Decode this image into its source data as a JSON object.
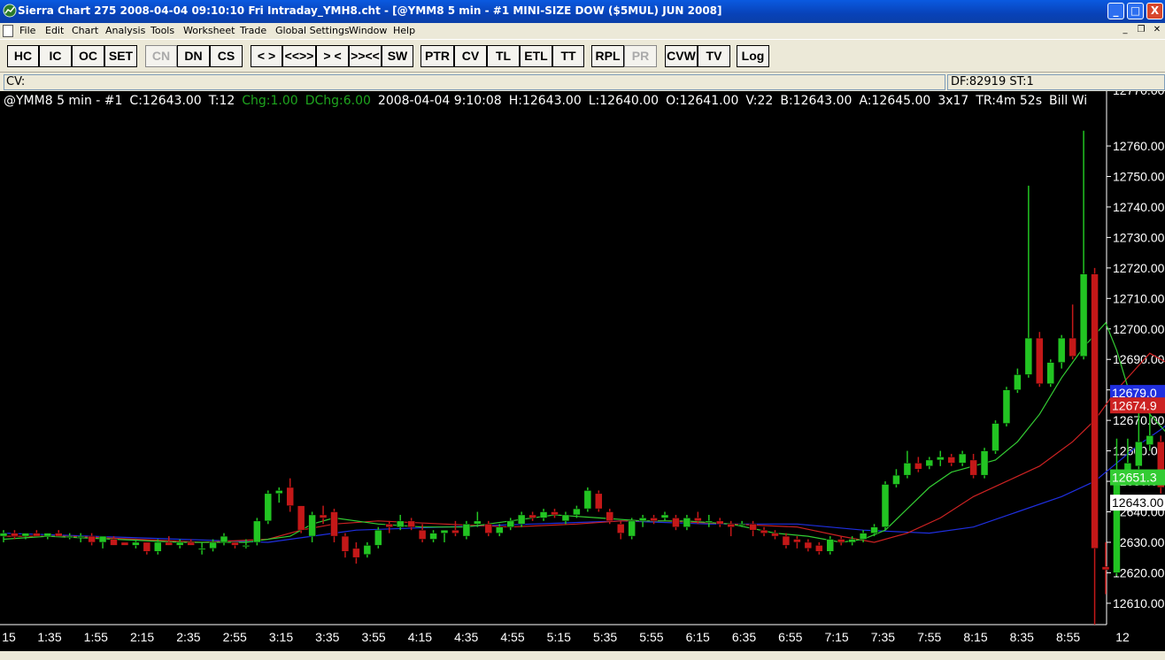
{
  "window": {
    "title": "Sierra Chart 275   2008-04-04   09:10:10   Fri    Intraday_YMH8.cht - [@YMM8   5 min   - #1 MINI-SIZE DOW ($5MUL) JUN 2008]",
    "minimize": "_",
    "maximize": "□",
    "close": "X"
  },
  "menu": [
    "File",
    "Edit",
    "Chart",
    "Analysis",
    "Tools",
    "Worksheet",
    "Trade",
    "Global Settings",
    "Window",
    "Help"
  ],
  "toolbar": [
    {
      "label": "HC",
      "enabled": true
    },
    {
      "label": "IC",
      "enabled": true
    },
    {
      "label": "OC",
      "enabled": true
    },
    {
      "label": "SET",
      "enabled": true
    },
    {
      "label": "CN",
      "enabled": false
    },
    {
      "label": "DN",
      "enabled": true
    },
    {
      "label": "CS",
      "enabled": true
    },
    {
      "label": "< >",
      "enabled": true
    },
    {
      "label": "<<>>",
      "enabled": true
    },
    {
      "label": "> <",
      "enabled": true
    },
    {
      "label": ">><<",
      "enabled": true
    },
    {
      "label": "SW",
      "enabled": true
    },
    {
      "label": "PTR",
      "enabled": true
    },
    {
      "label": "CV",
      "enabled": true
    },
    {
      "label": "TL",
      "enabled": true
    },
    {
      "label": "ETL",
      "enabled": true
    },
    {
      "label": "TT",
      "enabled": true
    },
    {
      "label": "RPL",
      "enabled": true
    },
    {
      "label": "PR",
      "enabled": false
    },
    {
      "label": "CVW",
      "enabled": true
    },
    {
      "label": "TV",
      "enabled": true
    },
    {
      "label": "Log",
      "enabled": true
    }
  ],
  "cv": {
    "label": "CV:",
    "info": "DF:82919  ST:1"
  },
  "status": {
    "symbol": "@YMM8  5 min   - #1",
    "close": "C:12643.00",
    "ticks": "T:12",
    "chg": "Chg:1.00",
    "dchg": "DChg:6.00",
    "datetime": "2008-04-04   9:10:08",
    "high": "H:12643.00",
    "low": "L:12640.00",
    "open": "O:12641.00",
    "volume": "V:22",
    "bid": "B:12643.00",
    "ask": "A:12645.00",
    "size": "3x17",
    "tr": "TR:4m 52s",
    "extra": "Bill Wi"
  },
  "colors": {
    "up": "#22c422",
    "down": "#c41818",
    "ma_green": "#33cc33",
    "ma_red": "#cc2222",
    "ma_blue": "#1f2fe0",
    "bg": "#000000",
    "axis_text": "#ffffff"
  },
  "chart_data": {
    "type": "candlestick",
    "symbol": "@YMM8",
    "interval": "5 min",
    "ylim": [
      12603,
      12778
    ],
    "y_ticks": [
      12760,
      12750,
      12740,
      12730,
      12720,
      12710,
      12700,
      12690,
      12680,
      12670,
      12660,
      12650,
      12640,
      12630,
      12620,
      12610
    ],
    "x_ticks": [
      "15",
      "1:35",
      "1:55",
      "2:15",
      "2:35",
      "2:55",
      "3:15",
      "3:35",
      "3:55",
      "4:15",
      "4:35",
      "4:55",
      "5:15",
      "5:35",
      "5:55",
      "6:15",
      "6:35",
      "6:55",
      "7:15",
      "7:35",
      "7:55",
      "8:15",
      "8:35",
      "8:55",
      "12"
    ],
    "price_labels": [
      {
        "text": "12679.0",
        "color": "#1f2fe0",
        "value": 12679
      },
      {
        "text": "12674.9",
        "color": "#cc2222",
        "value": 12674.9
      },
      {
        "text": "12651.3",
        "color": "#33cc33",
        "value": 12651.3
      },
      {
        "text": "12643.00",
        "color": "#ffffff",
        "value": 12643
      }
    ],
    "candles": [
      [
        12632,
        12634,
        12630,
        12633
      ],
      [
        12633,
        12634,
        12631,
        12632
      ],
      [
        12632,
        12633,
        12631,
        12633
      ],
      [
        12633,
        12634,
        12632,
        12632
      ],
      [
        12632,
        12633,
        12631,
        12633
      ],
      [
        12633,
        12634,
        12632,
        12632
      ],
      [
        12632,
        12633,
        12631,
        12632
      ],
      [
        12632,
        12633,
        12630,
        12632
      ],
      [
        12632,
        12633,
        12629,
        12630
      ],
      [
        12630,
        12632,
        12628,
        12632
      ],
      [
        12631,
        12632,
        12629,
        12629
      ],
      [
        12630,
        12630,
        12629,
        12629
      ],
      [
        12629,
        12631,
        12628,
        12630
      ],
      [
        12630,
        12630,
        12626,
        12627
      ],
      [
        12627,
        12631,
        12626,
        12630
      ],
      [
        12630,
        12632,
        12629,
        12629
      ],
      [
        12629,
        12631,
        12628,
        12630
      ],
      [
        12630,
        12631,
        12629,
        12629
      ],
      [
        12628,
        12630,
        12626,
        12628
      ],
      [
        12628,
        12631,
        12627,
        12630
      ],
      [
        12630,
        12633,
        12629,
        12632
      ],
      [
        12630,
        12630,
        12628,
        12629
      ],
      [
        12629,
        12631,
        12628,
        12629
      ],
      [
        12630,
        12638,
        12629,
        12637
      ],
      [
        12637,
        12647,
        12636,
        12646
      ],
      [
        12646,
        12648,
        12643,
        12647
      ],
      [
        12648,
        12651,
        12640,
        12642
      ],
      [
        12642,
        12642,
        12633,
        12634
      ],
      [
        12632,
        12640,
        12630,
        12639
      ],
      [
        12639,
        12642,
        12636,
        12638
      ],
      [
        12640,
        12641,
        12630,
        12632
      ],
      [
        12632,
        12633,
        12625,
        12627
      ],
      [
        12628,
        12630,
        12623,
        12625
      ],
      [
        12626,
        12630,
        12625,
        12629
      ],
      [
        12629,
        12635,
        12628,
        12634
      ],
      [
        12636,
        12637,
        12633,
        12635
      ],
      [
        12635,
        12639,
        12634,
        12637
      ],
      [
        12637,
        12638,
        12634,
        12635
      ],
      [
        12634,
        12636,
        12630,
        12631
      ],
      [
        12631,
        12634,
        12630,
        12633
      ],
      [
        12633,
        12634,
        12630,
        12634
      ],
      [
        12634,
        12637,
        12632,
        12633
      ],
      [
        12632,
        12637,
        12631,
        12636
      ],
      [
        12636,
        12640,
        12635,
        12637
      ],
      [
        12636,
        12637,
        12632,
        12633
      ],
      [
        12633,
        12636,
        12632,
        12635
      ],
      [
        12635,
        12638,
        12634,
        12637
      ],
      [
        12636,
        12640,
        12635,
        12639
      ],
      [
        12639,
        12640,
        12637,
        12638
      ],
      [
        12638,
        12641,
        12637,
        12640
      ],
      [
        12640,
        12641,
        12638,
        12639
      ],
      [
        12637,
        12640,
        12636,
        12639
      ],
      [
        12639,
        12642,
        12638,
        12641
      ],
      [
        12641,
        12648,
        12640,
        12647
      ],
      [
        12646,
        12647,
        12640,
        12641
      ],
      [
        12640,
        12641,
        12636,
        12637
      ],
      [
        12636,
        12637,
        12631,
        12633
      ],
      [
        12632,
        12638,
        12631,
        12637
      ],
      [
        12637,
        12639,
        12635,
        12638
      ],
      [
        12638,
        12639,
        12636,
        12637
      ],
      [
        12638,
        12640,
        12637,
        12639
      ],
      [
        12638,
        12639,
        12634,
        12635
      ],
      [
        12635,
        12639,
        12634,
        12638
      ],
      [
        12638,
        12640,
        12636,
        12637
      ],
      [
        12637,
        12639,
        12635,
        12637
      ],
      [
        12637,
        12638,
        12635,
        12636
      ],
      [
        12636,
        12637,
        12632,
        12635
      ],
      [
        12636,
        12637,
        12635,
        12636
      ],
      [
        12636,
        12637,
        12632,
        12634
      ],
      [
        12634,
        12635,
        12632,
        12633
      ],
      [
        12633,
        12634,
        12631,
        12632
      ],
      [
        12632,
        12633,
        12628,
        12629
      ],
      [
        12631,
        12632,
        12628,
        12630
      ],
      [
        12630,
        12631,
        12627,
        12628
      ],
      [
        12629,
        12630,
        12626,
        12627
      ],
      [
        12627,
        12632,
        12626,
        12631
      ],
      [
        12631,
        12632,
        12629,
        12630
      ],
      [
        12630,
        12632,
        12629,
        12631
      ],
      [
        12631,
        12634,
        12630,
        12633
      ],
      [
        12633,
        12636,
        12632,
        12635
      ],
      [
        12635,
        12650,
        12634,
        12649
      ],
      [
        12649,
        12654,
        12648,
        12652
      ],
      [
        12652,
        12660,
        12651,
        12656
      ],
      [
        12656,
        12658,
        12653,
        12654
      ],
      [
        12655,
        12658,
        12654,
        12657
      ],
      [
        12657,
        12660,
        12655,
        12658
      ],
      [
        12658,
        12659,
        12655,
        12656
      ],
      [
        12656,
        12660,
        12655,
        12659
      ],
      [
        12657,
        12659,
        12651,
        12652
      ],
      [
        12652,
        12661,
        12651,
        12660
      ],
      [
        12660,
        12670,
        12659,
        12669
      ],
      [
        12669,
        12681,
        12668,
        12680
      ],
      [
        12680,
        12687,
        12679,
        12685
      ],
      [
        12685,
        12747,
        12684,
        12697
      ],
      [
        12697,
        12699,
        12681,
        12682
      ],
      [
        12682,
        12690,
        12681,
        12689
      ],
      [
        12689,
        12698,
        12687,
        12697
      ],
      [
        12697,
        12708,
        12690,
        12691
      ],
      [
        12691,
        12765,
        12690,
        12718
      ],
      [
        12718,
        12720,
        12603,
        12628
      ],
      [
        12622,
        12630,
        12613,
        12621
      ],
      [
        12620,
        12664,
        12619,
        12653
      ],
      [
        12652,
        12664,
        12651,
        12656
      ],
      [
        12655,
        12673,
        12654,
        12663
      ],
      [
        12662,
        12674,
        12660,
        12665
      ],
      [
        12663,
        12665,
        12646,
        12648
      ],
      [
        12648,
        12652,
        12640,
        12641
      ],
      [
        12641,
        12645,
        12640,
        12643
      ]
    ],
    "ma_green": [
      [
        0,
        12631
      ],
      [
        4,
        12632
      ],
      [
        10,
        12631
      ],
      [
        16,
        12630
      ],
      [
        22,
        12630
      ],
      [
        26,
        12632
      ],
      [
        28,
        12636
      ],
      [
        30,
        12638
      ],
      [
        34,
        12636
      ],
      [
        38,
        12635
      ],
      [
        42,
        12635
      ],
      [
        46,
        12637
      ],
      [
        50,
        12639
      ],
      [
        54,
        12638
      ],
      [
        58,
        12637
      ],
      [
        62,
        12637
      ],
      [
        66,
        12636
      ],
      [
        70,
        12633
      ],
      [
        73,
        12632
      ],
      [
        76,
        12630
      ],
      [
        78,
        12631
      ],
      [
        80,
        12634
      ],
      [
        82,
        12641
      ],
      [
        84,
        12648
      ],
      [
        86,
        12653
      ],
      [
        88,
        12655
      ],
      [
        90,
        12657
      ],
      [
        92,
        12663
      ],
      [
        94,
        12672
      ],
      [
        96,
        12684
      ],
      [
        98,
        12694
      ],
      [
        100,
        12702
      ],
      [
        101,
        12693
      ],
      [
        102,
        12681
      ],
      [
        104,
        12672
      ],
      [
        106,
        12664
      ],
      [
        108,
        12655
      ]
    ],
    "ma_red": [
      [
        0,
        12632
      ],
      [
        6,
        12632
      ],
      [
        12,
        12631
      ],
      [
        18,
        12630
      ],
      [
        24,
        12631
      ],
      [
        27,
        12634
      ],
      [
        30,
        12636
      ],
      [
        34,
        12637
      ],
      [
        40,
        12636
      ],
      [
        46,
        12635
      ],
      [
        52,
        12636
      ],
      [
        56,
        12637
      ],
      [
        60,
        12637
      ],
      [
        66,
        12636
      ],
      [
        72,
        12635
      ],
      [
        76,
        12632
      ],
      [
        79,
        12630
      ],
      [
        82,
        12633
      ],
      [
        85,
        12638
      ],
      [
        88,
        12645
      ],
      [
        91,
        12650
      ],
      [
        94,
        12655
      ],
      [
        97,
        12663
      ],
      [
        99,
        12670
      ],
      [
        101,
        12680
      ],
      [
        102,
        12684
      ],
      [
        103,
        12688
      ],
      [
        104,
        12692
      ],
      [
        106,
        12688
      ],
      [
        108,
        12680
      ]
    ],
    "ma_blue": [
      [
        0,
        12633
      ],
      [
        8,
        12632
      ],
      [
        16,
        12631
      ],
      [
        24,
        12630
      ],
      [
        32,
        12634
      ],
      [
        40,
        12635
      ],
      [
        48,
        12636
      ],
      [
        56,
        12637
      ],
      [
        64,
        12636
      ],
      [
        72,
        12636
      ],
      [
        78,
        12634
      ],
      [
        84,
        12633
      ],
      [
        88,
        12635
      ],
      [
        92,
        12640
      ],
      [
        96,
        12645
      ],
      [
        99,
        12650
      ],
      [
        101,
        12656
      ],
      [
        103,
        12662
      ],
      [
        105,
        12667
      ],
      [
        107,
        12673
      ],
      [
        108,
        12679
      ]
    ]
  }
}
